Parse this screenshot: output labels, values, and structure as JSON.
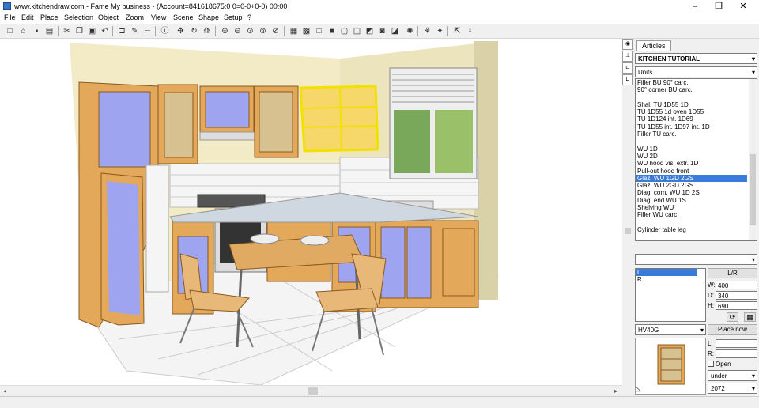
{
  "window": {
    "title": "www.kitchendraw.com - Fame My business - (Account=841618675:0 0=0-0+0-0) 00:00",
    "minimize_glyph": "–",
    "maximize_glyph": "❐",
    "close_glyph": "✕"
  },
  "menu": [
    "File",
    "Edit",
    "Place",
    "Selection",
    "Object",
    "Zoom",
    "View",
    "Scene",
    "Shape",
    "Setup",
    "?"
  ],
  "panel": {
    "tab_label": "Articles",
    "catalog_value": "KITCHEN TUTORIAL",
    "category_value": "Units",
    "articles": [
      "Filler BU 90° carc.",
      "90° corner BU carc.",
      "",
      "Shal. TU 1D55 1D",
      "TU 1D55 1d oven 1D55",
      "TU 1D124 int. 1D69",
      "TU 1D55 int. 1D97 int. 1D",
      "Filler TU carc.",
      "",
      "WU 1D",
      "WU 2D",
      "WU hood vis. extr. 1D",
      "Pull-out hood front",
      "Glaz. WU 1GD 2GS",
      "Glaz. WU 2GD 2GS",
      "Diag. corn. WU 1D 2S",
      "Diag. end WU 1S",
      "Shelving WU",
      "Filler WU carc.",
      "",
      "Cylinder table leg"
    ],
    "selected_article_index": 13,
    "variant_select_value": "",
    "variants": [
      "L",
      "R"
    ],
    "selected_variant_index": 0,
    "handing_button": "L/R",
    "dims": {
      "w_label": "W:",
      "w_value": "400",
      "d_label": "D:",
      "d_value": "340",
      "h_label": "H:",
      "h_value": "690"
    },
    "finish_value": "HV40G",
    "place_now_label": "Place now",
    "l_label": "L:",
    "r_label": "R:",
    "open_label": "Open",
    "position_value": "under",
    "height_value": "2072"
  }
}
